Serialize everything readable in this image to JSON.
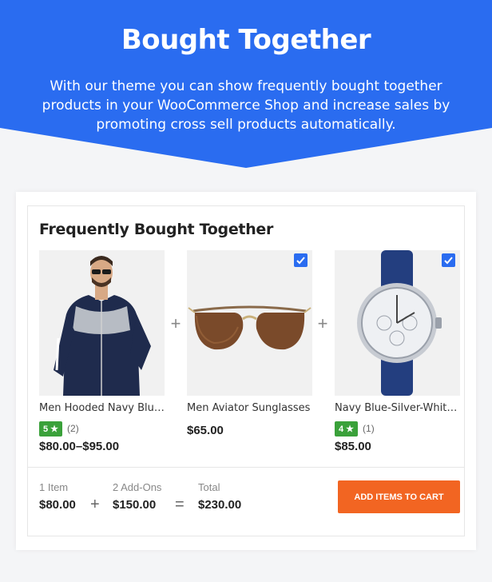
{
  "hero": {
    "title": "Bought Together",
    "description": "With our theme you can show frequently bought together products in your WooCommerce Shop and increase sales by promoting cross sell products automatically.",
    "color": "#2a6cf0"
  },
  "widget": {
    "title": "Frequently Bought Together",
    "products": [
      {
        "name": "Men Hooded Navy Blue ...",
        "rating": "5",
        "rating_count": "(2)",
        "price": "$80.00–$95.00",
        "checked": false
      },
      {
        "name": "Men Aviator Sunglasses",
        "price": "$65.00",
        "checked": true
      },
      {
        "name": "Navy Blue-Silver-White ...",
        "rating": "4",
        "rating_count": "(1)",
        "price": "$85.00",
        "checked": true
      }
    ],
    "plus_symbol": "+",
    "summary": {
      "items_label": "1 Item",
      "items_value": "$80.00",
      "addons_label": "2 Add-Ons",
      "addons_value": "$150.00",
      "total_label": "Total",
      "total_value": "$230.00",
      "plus_symbol": "+",
      "equals_symbol": "="
    },
    "cart_button": "ADD ITEMS TO CART",
    "colors": {
      "accent": "#2a6cf0",
      "button": "#f26522",
      "rating": "#3aa13a"
    }
  }
}
